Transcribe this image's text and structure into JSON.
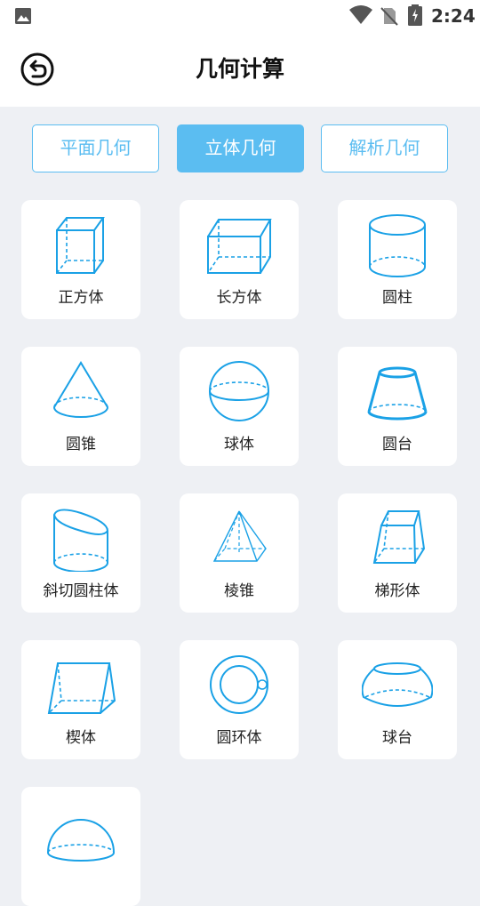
{
  "status_bar": {
    "time": "2:24"
  },
  "header": {
    "title": "几何计算"
  },
  "tabs": [
    {
      "label": "平面几何",
      "active": false
    },
    {
      "label": "立体几何",
      "active": true
    },
    {
      "label": "解析几何",
      "active": false
    }
  ],
  "shapes": [
    {
      "label": "正方体",
      "icon": "cube-icon"
    },
    {
      "label": "长方体",
      "icon": "cuboid-icon"
    },
    {
      "label": "圆柱",
      "icon": "cylinder-icon"
    },
    {
      "label": "圆锥",
      "icon": "cone-icon"
    },
    {
      "label": "球体",
      "icon": "sphere-icon"
    },
    {
      "label": "圆台",
      "icon": "frustum-icon"
    },
    {
      "label": "斜切圆柱体",
      "icon": "oblique-cylinder-icon"
    },
    {
      "label": "棱锥",
      "icon": "pyramid-icon"
    },
    {
      "label": "梯形体",
      "icon": "trapezoid-solid-icon"
    },
    {
      "label": "楔体",
      "icon": "wedge-icon"
    },
    {
      "label": "圆环体",
      "icon": "torus-icon"
    },
    {
      "label": "球台",
      "icon": "spherical-frustum-icon"
    },
    {
      "label": "",
      "icon": "hemisphere-icon"
    }
  ],
  "colors": {
    "accent": "#5bbdf1",
    "icon_stroke": "#1aa1e6",
    "background": "#eef0f4"
  }
}
